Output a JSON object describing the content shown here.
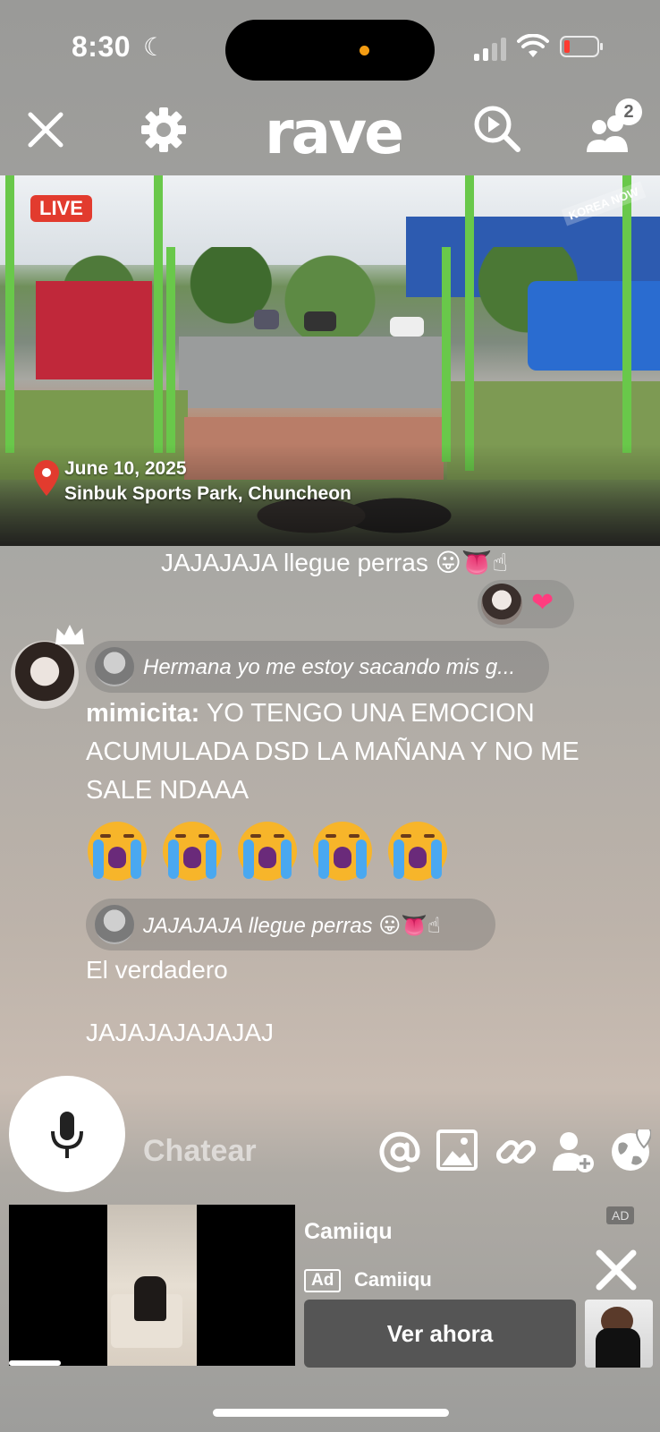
{
  "status_bar": {
    "time": "8:30",
    "moon": "☾"
  },
  "header": {
    "logo": "rave",
    "participants_count": "2"
  },
  "video": {
    "live_label": "LIVE",
    "watermark": "KOREA NOW",
    "date": "June 10, 2025",
    "location": "Sinbuk Sports Park, Chuncheon"
  },
  "chat": {
    "top_message": "JAJAJAJA llegue perras",
    "top_message_emoji": "😛👅☝",
    "reaction_emoji": "❤",
    "reply_preview_1": "Hermana yo me estoy sacando mis g...",
    "username": "mimicita:",
    "message": "YO TENGO UNA EMOCION ACUMULADA DSD LA MAÑANA Y NO ME SALE NDAAA",
    "reply_preview_2": "JAJAJAJA llegue perras",
    "reply_preview_2_emoji": "😛👅☝",
    "line_1": "El verdadero",
    "line_2": "JAJAJAJAJAJAJ"
  },
  "input": {
    "placeholder": "Chatear"
  },
  "ad": {
    "title": "Camiiqu",
    "tag": "Ad",
    "brand": "Camiiqu",
    "cta": "Ver ahora",
    "ad_label": "AD"
  },
  "colors": {
    "live_red": "#e23b2e",
    "battery_low": "#ff3b30",
    "cta_bg": "#555555"
  }
}
